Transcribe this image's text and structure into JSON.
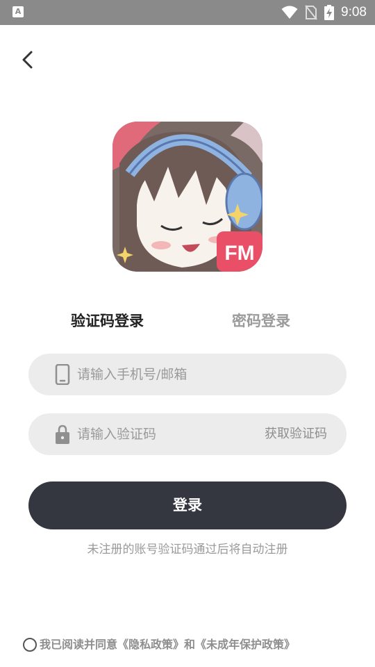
{
  "status_bar": {
    "app_icon_letter": "A",
    "time": "9:08"
  },
  "tabs": {
    "code_login": "验证码登录",
    "password_login": "密码登录"
  },
  "phone_field": {
    "placeholder": "请输入手机号/邮箱",
    "value": ""
  },
  "code_field": {
    "placeholder": "请输入验证码",
    "value": "",
    "get_code_label": "获取验证码"
  },
  "login_button": "登录",
  "hint": "未注册的账号验证码通过后将自动注册",
  "agreement": {
    "prefix": "我已阅读并同意",
    "privacy_policy": "《隐私政策》",
    "and": "和",
    "minor_policy": "《未成年保护政策》",
    "checked": false
  },
  "logo": {
    "badge_text": "FM"
  },
  "colors": {
    "primary_button": "#343640",
    "field_background": "#ececec",
    "status_bar": "#8a8a8a",
    "tab_active": "#222222",
    "tab_inactive": "#9b9b9b"
  }
}
